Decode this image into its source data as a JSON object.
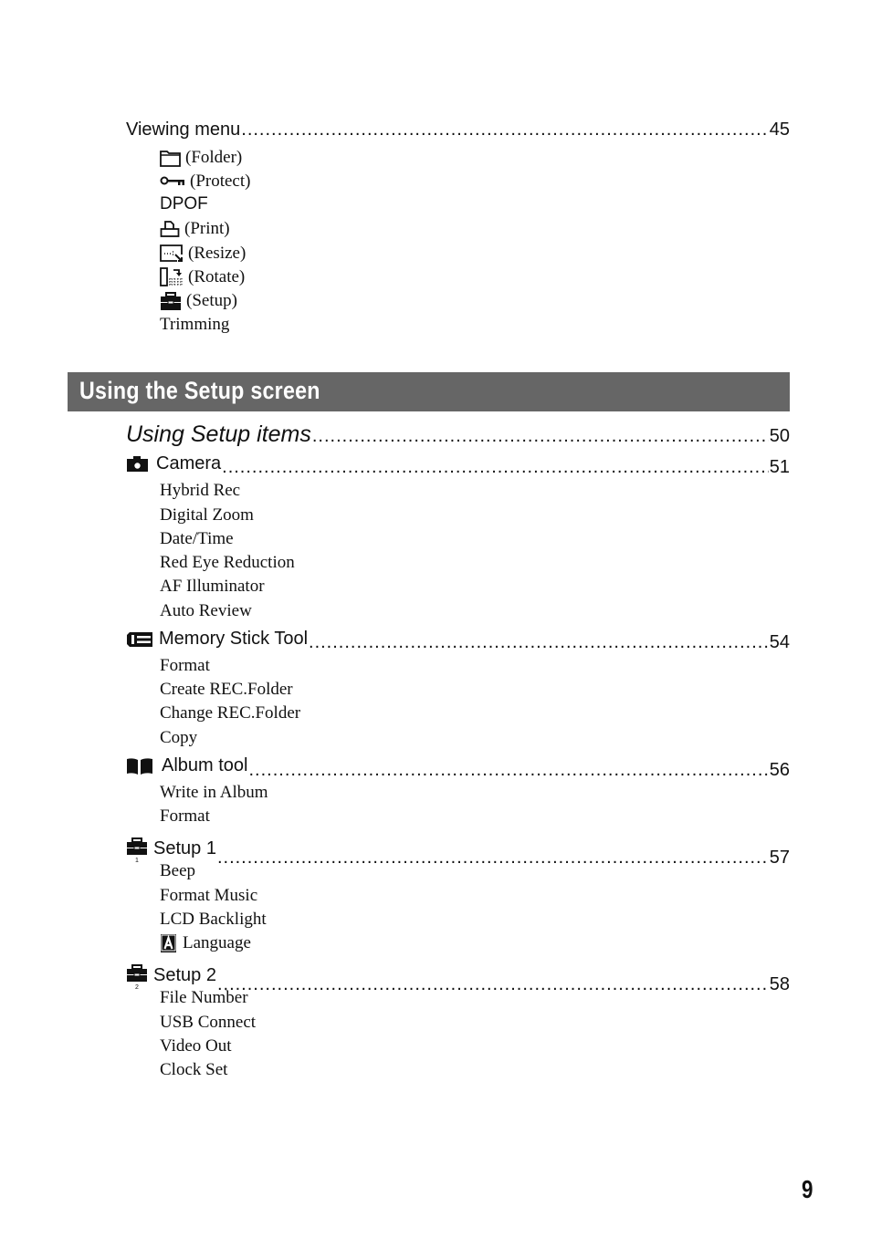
{
  "viewing_menu": {
    "title": "Viewing menu",
    "page": "45",
    "items": [
      {
        "icon": "folder-icon",
        "label": "(Folder)"
      },
      {
        "icon": "key-icon",
        "label": "(Protect)"
      },
      {
        "icon": "",
        "label": "DPOF"
      },
      {
        "icon": "print-icon",
        "label": "(Print)"
      },
      {
        "icon": "resize-icon",
        "label": "(Resize)"
      },
      {
        "icon": "rotate-icon",
        "label": "(Rotate)"
      },
      {
        "icon": "toolbox-icon",
        "label": "(Setup)"
      },
      {
        "icon": "",
        "label": "Trimming"
      }
    ]
  },
  "section_banner": "Using the Setup screen",
  "setup_items": {
    "title": "Using Setup items",
    "page": "50"
  },
  "groups": [
    {
      "icon": "camera-icon",
      "title": "Camera",
      "page": "51",
      "items": [
        "Hybrid Rec",
        "Digital Zoom",
        "Date/Time",
        "Red Eye Reduction",
        "AF Illuminator",
        "Auto Review"
      ]
    },
    {
      "icon": "memory-stick-icon",
      "title": "Memory Stick Tool",
      "page": "54",
      "items": [
        "Format",
        "Create REC.Folder",
        "Change REC.Folder",
        "Copy"
      ]
    },
    {
      "icon": "album-book-icon",
      "title": "Album tool",
      "page": "56",
      "items": [
        "Write in Album",
        "Format"
      ]
    },
    {
      "icon": "setup1-toolbox-icon",
      "title": "Setup 1",
      "page": "57",
      "items": [
        "Beep",
        "Format Music",
        "LCD Backlight",
        "Language"
      ]
    },
    {
      "icon": "setup2-toolbox-icon",
      "title": "Setup 2",
      "page": "58",
      "items": [
        "File Number",
        "USB Connect",
        "Video Out",
        "Clock Set"
      ]
    }
  ],
  "page_number": "9"
}
